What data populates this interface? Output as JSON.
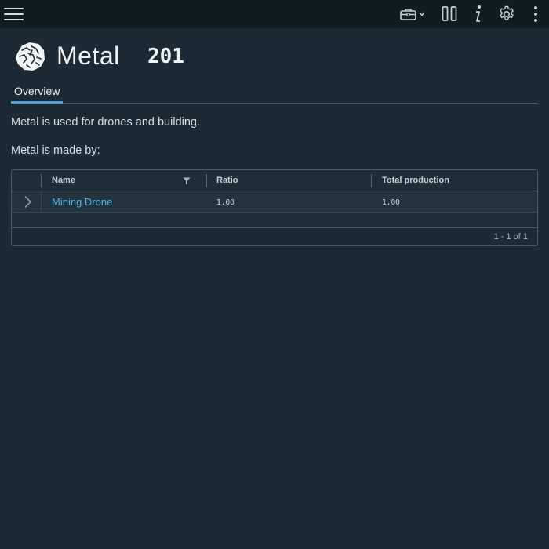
{
  "topbar": {
    "menu_icon": "hamburger-menu-icon",
    "actions": [
      {
        "icon": "toolbox-icon",
        "has_dropdown": true
      },
      {
        "icon": "columns-icon"
      },
      {
        "icon": "info-icon"
      },
      {
        "icon": "gear-icon"
      },
      {
        "icon": "more-vertical-icon"
      }
    ]
  },
  "resource": {
    "icon": "metal-ore-icon",
    "name": "Metal",
    "amount": "201"
  },
  "tabs": [
    {
      "label": "Overview",
      "active": true
    }
  ],
  "overview": {
    "description": "Metal is used for drones and building.",
    "made_by_label": "Metal is made by:"
  },
  "table": {
    "columns": [
      "Name",
      "Ratio",
      "Total production"
    ],
    "rows": [
      {
        "name": "Mining Drone",
        "ratio": "1.00",
        "total_production": "1.00"
      }
    ],
    "pagination": "1 - 1 of 1"
  },
  "colors": {
    "background": "#1b2a35",
    "topbar": "#111b22",
    "accent": "#49a4d3",
    "link": "#4fb0df"
  }
}
